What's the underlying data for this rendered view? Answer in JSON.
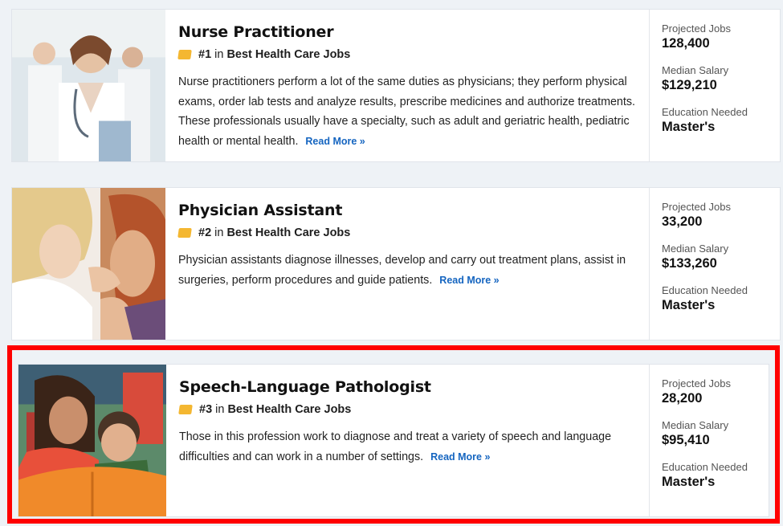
{
  "jobs": [
    {
      "title": "Nurse Practitioner",
      "rank": "#1",
      "rank_in": "in",
      "rank_list": "Best Health Care Jobs",
      "description": "Nurse practitioners perform a lot of the same duties as physicians; they perform physical exams, order lab tests and analyze results, prescribe medicines and authorize treatments. These professionals usually have a specialty, such as adult and geriatric health, pediatric health or mental health.",
      "read_more": "Read More »",
      "projected_jobs_label": "Projected Jobs",
      "projected_jobs": "128,400",
      "median_salary_label": "Median Salary",
      "median_salary": "$129,210",
      "education_label": "Education Needed",
      "education": "Master's",
      "image_icon": "nurse-practitioner-photo"
    },
    {
      "title": "Physician Assistant",
      "rank": "#2",
      "rank_in": "in",
      "rank_list": "Best Health Care Jobs",
      "description": "Physician assistants diagnose illnesses, develop and carry out treatment plans, assist in surgeries, perform procedures and guide patients.",
      "read_more": "Read More »",
      "projected_jobs_label": "Projected Jobs",
      "projected_jobs": "33,200",
      "median_salary_label": "Median Salary",
      "median_salary": "$133,260",
      "education_label": "Education Needed",
      "education": "Master's",
      "image_icon": "physician-assistant-photo"
    },
    {
      "title": "Speech-Language Pathologist",
      "rank": "#3",
      "rank_in": "in",
      "rank_list": "Best Health Care Jobs",
      "description": "Those in this profession work to diagnose and treat a variety of speech and language difficulties and can work in a number of settings.",
      "read_more": "Read More »",
      "projected_jobs_label": "Projected Jobs",
      "projected_jobs": "28,200",
      "median_salary_label": "Median Salary",
      "median_salary": "$95,410",
      "education_label": "Education Needed",
      "education": "Master's",
      "image_icon": "speech-pathologist-photo"
    }
  ],
  "colors": {
    "link": "#1565c0",
    "badge": "#f4b731",
    "highlight": "#ff0000",
    "page_bg": "#eef2f6"
  }
}
